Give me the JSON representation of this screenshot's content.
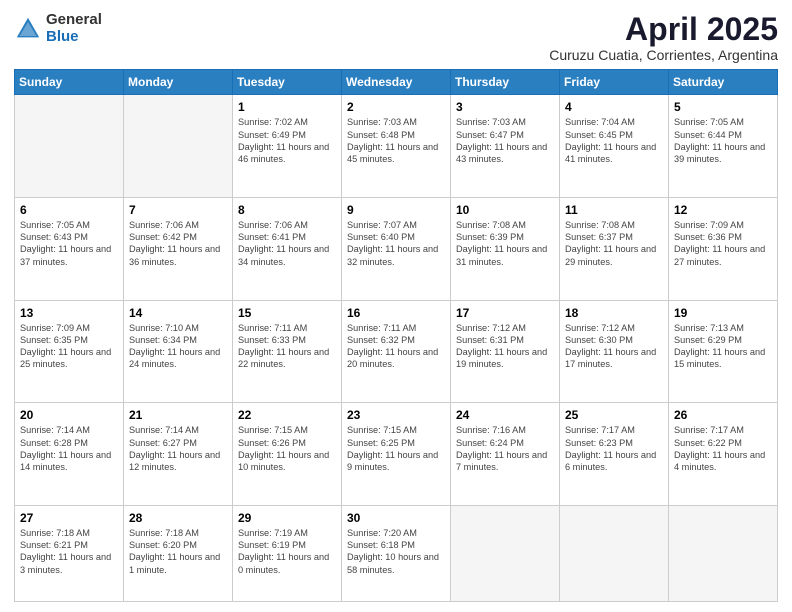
{
  "logo": {
    "general": "General",
    "blue": "Blue"
  },
  "title": "April 2025",
  "subtitle": "Curuzu Cuatia, Corrientes, Argentina",
  "days_header": [
    "Sunday",
    "Monday",
    "Tuesday",
    "Wednesday",
    "Thursday",
    "Friday",
    "Saturday"
  ],
  "weeks": [
    [
      {
        "num": "",
        "info": ""
      },
      {
        "num": "",
        "info": ""
      },
      {
        "num": "1",
        "info": "Sunrise: 7:02 AM\nSunset: 6:49 PM\nDaylight: 11 hours and 46 minutes."
      },
      {
        "num": "2",
        "info": "Sunrise: 7:03 AM\nSunset: 6:48 PM\nDaylight: 11 hours and 45 minutes."
      },
      {
        "num": "3",
        "info": "Sunrise: 7:03 AM\nSunset: 6:47 PM\nDaylight: 11 hours and 43 minutes."
      },
      {
        "num": "4",
        "info": "Sunrise: 7:04 AM\nSunset: 6:45 PM\nDaylight: 11 hours and 41 minutes."
      },
      {
        "num": "5",
        "info": "Sunrise: 7:05 AM\nSunset: 6:44 PM\nDaylight: 11 hours and 39 minutes."
      }
    ],
    [
      {
        "num": "6",
        "info": "Sunrise: 7:05 AM\nSunset: 6:43 PM\nDaylight: 11 hours and 37 minutes."
      },
      {
        "num": "7",
        "info": "Sunrise: 7:06 AM\nSunset: 6:42 PM\nDaylight: 11 hours and 36 minutes."
      },
      {
        "num": "8",
        "info": "Sunrise: 7:06 AM\nSunset: 6:41 PM\nDaylight: 11 hours and 34 minutes."
      },
      {
        "num": "9",
        "info": "Sunrise: 7:07 AM\nSunset: 6:40 PM\nDaylight: 11 hours and 32 minutes."
      },
      {
        "num": "10",
        "info": "Sunrise: 7:08 AM\nSunset: 6:39 PM\nDaylight: 11 hours and 31 minutes."
      },
      {
        "num": "11",
        "info": "Sunrise: 7:08 AM\nSunset: 6:37 PM\nDaylight: 11 hours and 29 minutes."
      },
      {
        "num": "12",
        "info": "Sunrise: 7:09 AM\nSunset: 6:36 PM\nDaylight: 11 hours and 27 minutes."
      }
    ],
    [
      {
        "num": "13",
        "info": "Sunrise: 7:09 AM\nSunset: 6:35 PM\nDaylight: 11 hours and 25 minutes."
      },
      {
        "num": "14",
        "info": "Sunrise: 7:10 AM\nSunset: 6:34 PM\nDaylight: 11 hours and 24 minutes."
      },
      {
        "num": "15",
        "info": "Sunrise: 7:11 AM\nSunset: 6:33 PM\nDaylight: 11 hours and 22 minutes."
      },
      {
        "num": "16",
        "info": "Sunrise: 7:11 AM\nSunset: 6:32 PM\nDaylight: 11 hours and 20 minutes."
      },
      {
        "num": "17",
        "info": "Sunrise: 7:12 AM\nSunset: 6:31 PM\nDaylight: 11 hours and 19 minutes."
      },
      {
        "num": "18",
        "info": "Sunrise: 7:12 AM\nSunset: 6:30 PM\nDaylight: 11 hours and 17 minutes."
      },
      {
        "num": "19",
        "info": "Sunrise: 7:13 AM\nSunset: 6:29 PM\nDaylight: 11 hours and 15 minutes."
      }
    ],
    [
      {
        "num": "20",
        "info": "Sunrise: 7:14 AM\nSunset: 6:28 PM\nDaylight: 11 hours and 14 minutes."
      },
      {
        "num": "21",
        "info": "Sunrise: 7:14 AM\nSunset: 6:27 PM\nDaylight: 11 hours and 12 minutes."
      },
      {
        "num": "22",
        "info": "Sunrise: 7:15 AM\nSunset: 6:26 PM\nDaylight: 11 hours and 10 minutes."
      },
      {
        "num": "23",
        "info": "Sunrise: 7:15 AM\nSunset: 6:25 PM\nDaylight: 11 hours and 9 minutes."
      },
      {
        "num": "24",
        "info": "Sunrise: 7:16 AM\nSunset: 6:24 PM\nDaylight: 11 hours and 7 minutes."
      },
      {
        "num": "25",
        "info": "Sunrise: 7:17 AM\nSunset: 6:23 PM\nDaylight: 11 hours and 6 minutes."
      },
      {
        "num": "26",
        "info": "Sunrise: 7:17 AM\nSunset: 6:22 PM\nDaylight: 11 hours and 4 minutes."
      }
    ],
    [
      {
        "num": "27",
        "info": "Sunrise: 7:18 AM\nSunset: 6:21 PM\nDaylight: 11 hours and 3 minutes."
      },
      {
        "num": "28",
        "info": "Sunrise: 7:18 AM\nSunset: 6:20 PM\nDaylight: 11 hours and 1 minute."
      },
      {
        "num": "29",
        "info": "Sunrise: 7:19 AM\nSunset: 6:19 PM\nDaylight: 11 hours and 0 minutes."
      },
      {
        "num": "30",
        "info": "Sunrise: 7:20 AM\nSunset: 6:18 PM\nDaylight: 10 hours and 58 minutes."
      },
      {
        "num": "",
        "info": ""
      },
      {
        "num": "",
        "info": ""
      },
      {
        "num": "",
        "info": ""
      }
    ]
  ]
}
